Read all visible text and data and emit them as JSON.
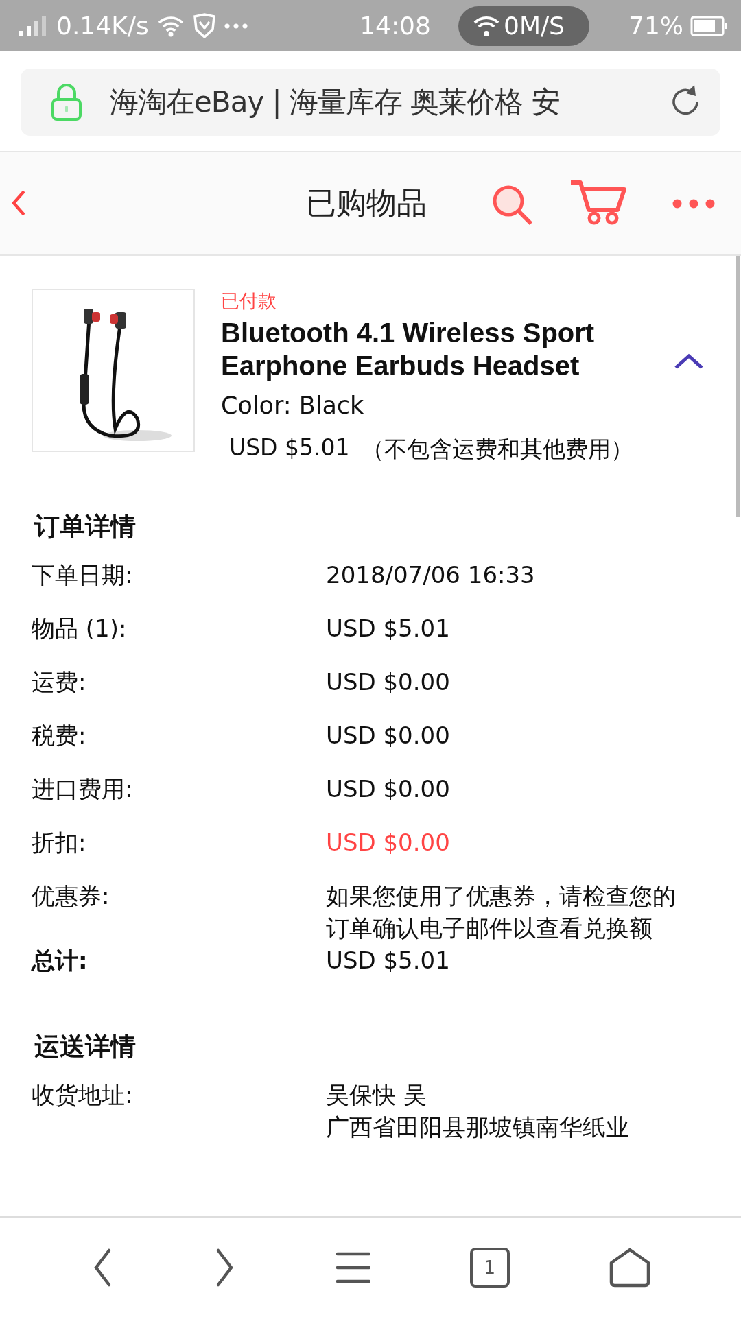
{
  "status_bar": {
    "net_speed": "0.14K/s",
    "time": "14:08",
    "hotspot_speed": "0M/S",
    "battery": "71%"
  },
  "address_bar": {
    "title": "海淘在eBay | 海量库存 奥莱价格 安"
  },
  "header": {
    "title": "已购物品"
  },
  "item": {
    "status": "已付款",
    "title": "Bluetooth 4.1 Wireless Sport Earphone Earbuds Headset",
    "attribute": "Color: Black",
    "price": "USD $5.01",
    "price_note": "（不包含运费和其他费用）",
    "expanded": true
  },
  "order_details": {
    "heading": "订单详情",
    "rows": [
      {
        "label": "下单日期:",
        "value": "2018/07/06 16:33",
        "kind": "plain"
      },
      {
        "label": "物品 (1):",
        "value": "USD $5.01",
        "kind": "plain"
      },
      {
        "label": "运费:",
        "value": "USD $0.00",
        "kind": "plain"
      },
      {
        "label": "税费:",
        "value": "USD $0.00",
        "kind": "plain"
      },
      {
        "label": "进口费用:",
        "value": "USD $0.00",
        "kind": "plain"
      },
      {
        "label": "折扣:",
        "value": "USD $0.00",
        "kind": "discount"
      },
      {
        "label": "优惠券:",
        "value": "如果您使用了优惠券，请检查您的订单确认电子邮件以查看兑换额",
        "kind": "plain"
      },
      {
        "label": "总计:",
        "value": "USD $5.01",
        "kind": "total"
      }
    ]
  },
  "shipping_details": {
    "heading": "运送详情",
    "rows": [
      {
        "label": "收货地址:",
        "lines": [
          "吴保快 吴",
          "广西省田阳县那坡镇南华纸业"
        ]
      }
    ]
  },
  "bottom_nav": {
    "tab_count": "1"
  }
}
